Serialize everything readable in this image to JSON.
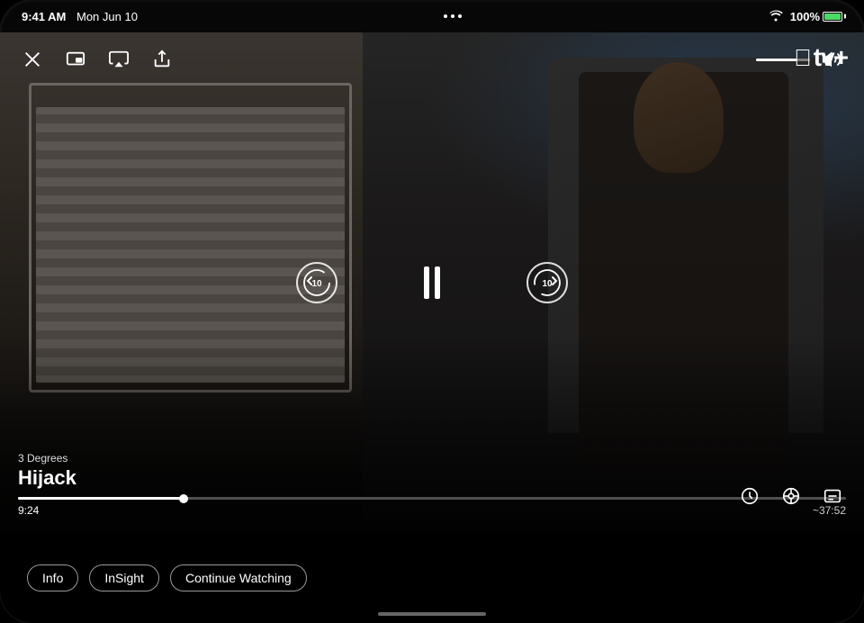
{
  "status_bar": {
    "time": "9:41 AM",
    "date": "Mon Jun 10",
    "battery_percent": "100%"
  },
  "apple_tv_logo": "tv+",
  "show": {
    "subtitle": "3 Degrees",
    "title": "Hijack"
  },
  "controls": {
    "skip_back_seconds": "10",
    "skip_forward_seconds": "10",
    "pause_label": "Pause"
  },
  "progress": {
    "current_time": "9:24",
    "remaining_time": "~37:52",
    "fill_percent": 20
  },
  "volume": {
    "level": 75
  },
  "bottom_buttons": [
    {
      "id": "info-btn",
      "label": "Info"
    },
    {
      "id": "insight-btn",
      "label": "InSight"
    },
    {
      "id": "continue-watching-btn",
      "label": "Continue Watching"
    }
  ],
  "icons": {
    "close": "✕",
    "picture_in_picture": "⧉",
    "airplay": "▱",
    "share": "⬆",
    "volume": "🔊",
    "playback_speed": "⊙",
    "subtitles": "⧈",
    "audio_options": "◈"
  }
}
